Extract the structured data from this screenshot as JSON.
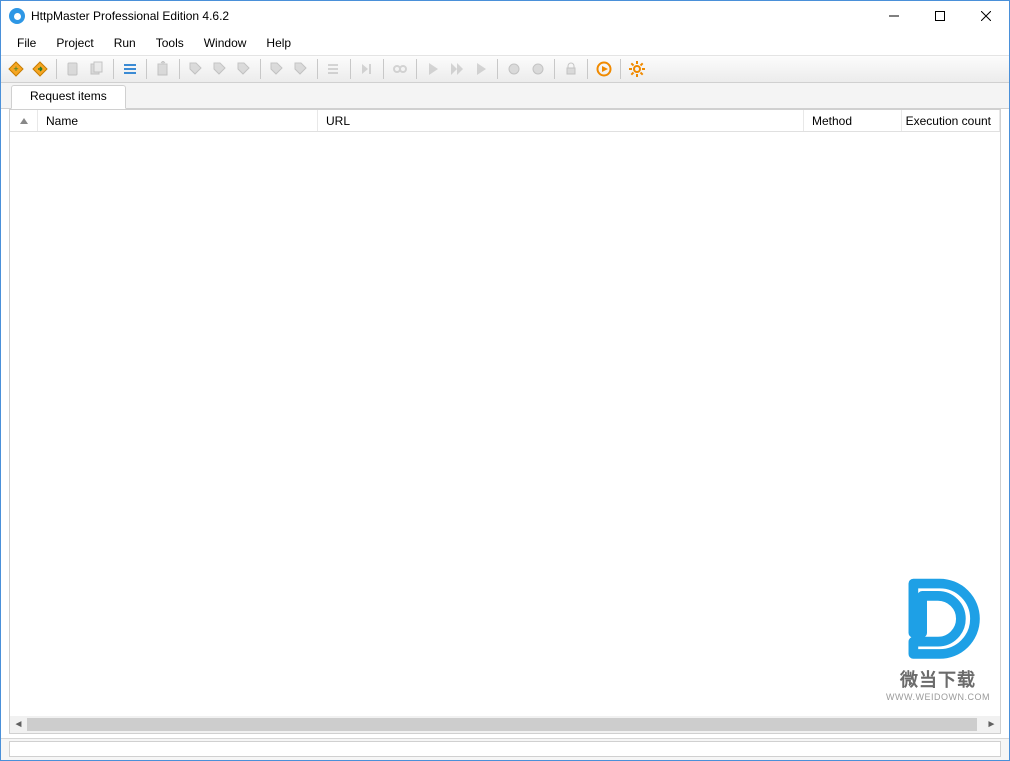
{
  "window": {
    "title": "HttpMaster Professional Edition 4.6.2"
  },
  "menu": {
    "file": "File",
    "project": "Project",
    "run": "Run",
    "tools": "Tools",
    "window": "Window",
    "help": "Help"
  },
  "toolbar": {
    "icons": [
      {
        "name": "new-project-icon",
        "enabled": true,
        "color": "orange",
        "shape": "diamond-plus"
      },
      {
        "name": "open-project-icon",
        "enabled": true,
        "color": "orange",
        "shape": "diamond-arrow"
      },
      {
        "name": "save-icon",
        "enabled": false,
        "color": "gray",
        "shape": "page"
      },
      {
        "name": "save-all-icon",
        "enabled": false,
        "color": "gray",
        "shape": "page-stack"
      },
      {
        "name": "properties-icon",
        "enabled": true,
        "color": "blue",
        "shape": "list"
      },
      {
        "name": "send-icon",
        "enabled": false,
        "color": "gray",
        "shape": "page-up"
      },
      {
        "name": "tag-plus-icon",
        "enabled": false,
        "color": "gray",
        "shape": "tag"
      },
      {
        "name": "tag-arrow-icon",
        "enabled": false,
        "color": "gray",
        "shape": "tag"
      },
      {
        "name": "tag-remove-icon",
        "enabled": false,
        "color": "gray",
        "shape": "tag"
      },
      {
        "name": "tags-icon",
        "enabled": false,
        "color": "gray",
        "shape": "tag"
      },
      {
        "name": "tag-manage-icon",
        "enabled": false,
        "color": "gray",
        "shape": "tag"
      },
      {
        "name": "list-order-icon",
        "enabled": false,
        "color": "gray",
        "shape": "list-lines"
      },
      {
        "name": "step-icon",
        "enabled": false,
        "color": "gray",
        "shape": "step"
      },
      {
        "name": "chain-icon",
        "enabled": false,
        "color": "gray",
        "shape": "link"
      },
      {
        "name": "play-icon",
        "enabled": false,
        "color": "gray",
        "shape": "play"
      },
      {
        "name": "play-all-icon",
        "enabled": false,
        "color": "gray",
        "shape": "play-double"
      },
      {
        "name": "play-next-icon",
        "enabled": false,
        "color": "gray",
        "shape": "play"
      },
      {
        "name": "record-a-icon",
        "enabled": false,
        "color": "gray",
        "shape": "disc"
      },
      {
        "name": "record-b-icon",
        "enabled": false,
        "color": "gray",
        "shape": "disc"
      },
      {
        "name": "lock-icon",
        "enabled": false,
        "color": "gray",
        "shape": "lock"
      },
      {
        "name": "execute-icon",
        "enabled": true,
        "color": "orange",
        "shape": "play-circle"
      },
      {
        "name": "settings-icon",
        "enabled": true,
        "color": "orange",
        "shape": "gear"
      }
    ]
  },
  "tab": {
    "label": "Request items"
  },
  "columns": {
    "name": "Name",
    "url": "URL",
    "method": "Method",
    "exec": "Execution count"
  },
  "watermark": {
    "text": "微当下载",
    "url": "WWW.WEIDOWN.COM"
  }
}
